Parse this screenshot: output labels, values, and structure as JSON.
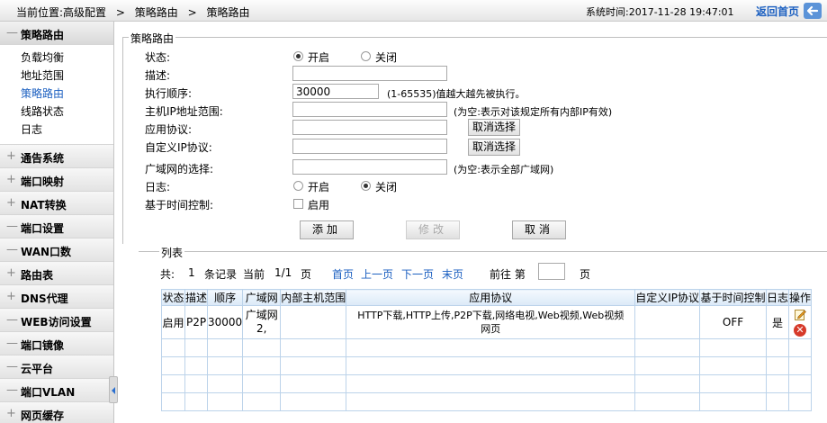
{
  "topbar": {
    "location_label": "当前位置:高级配置",
    "crumb_1": "策略路由",
    "crumb_2": "策略路由",
    "systime_label": "系统时间:",
    "systime_value": "2017-11-28 19:47:01",
    "home_link": "返回首页"
  },
  "sidebar": {
    "groups": [
      {
        "label": "策略路由",
        "state": "—"
      },
      {
        "label": "通告系统",
        "state": "+"
      },
      {
        "label": "端口映射",
        "state": "+"
      },
      {
        "label": "NAT转换",
        "state": "+"
      },
      {
        "label": "端口设置",
        "state": "—"
      },
      {
        "label": "WAN口数",
        "state": "—"
      },
      {
        "label": "路由表",
        "state": "+"
      },
      {
        "label": "DNS代理",
        "state": "+"
      },
      {
        "label": "WEB访问设置",
        "state": "—"
      },
      {
        "label": "端口镜像",
        "state": "—"
      },
      {
        "label": "云平台",
        "state": "—"
      },
      {
        "label": "端口VLAN",
        "state": "—"
      },
      {
        "label": "网页缓存",
        "state": "+"
      }
    ],
    "subitems": [
      "负载均衡",
      "地址范围",
      "策略路由",
      "线路状态",
      "日志"
    ]
  },
  "form": {
    "legend": "策略路由",
    "state_label": "状态:",
    "state_on": "开启",
    "state_off": "关闭",
    "desc_label": "描述:",
    "desc_value": "",
    "order_label": "执行顺序:",
    "order_value": "30000",
    "order_hint": "(1-65535)值越大越先被执行。",
    "host_label": "主机IP地址范围:",
    "host_value": "",
    "host_hint": "(为空:表示对该规定所有内部IP有效)",
    "app_label": "应用协议:",
    "app_value": "",
    "cancel_select": "取消选择",
    "custom_label": "自定义IP协议:",
    "custom_value": "",
    "wan_label": "广域网的选择:",
    "wan_value": "",
    "wan_hint": "(为空:表示全部广域网)",
    "log_label": "日志:",
    "log_on": "开启",
    "log_off": "关闭",
    "time_label": "基于时间控制:",
    "time_enable": "启用",
    "btn_add": "添加",
    "btn_modify": "修改",
    "btn_cancel": "取消"
  },
  "list": {
    "legend": "列表",
    "total_prefix": "共:",
    "total_count": "1",
    "total_suffix": "条记录",
    "current_label": "当前",
    "page_info": "1/1",
    "page_unit": "页",
    "first": "首页",
    "prev": "上一页",
    "next": "下一页",
    "last": "末页",
    "goto_label": "前往 第",
    "goto_value": "",
    "goto_unit": "页",
    "columns": [
      "状态",
      "描述",
      "顺序",
      "广域网",
      "内部主机范围",
      "应用协议",
      "自定义IP协议",
      "基于时间控制",
      "日志",
      "操作"
    ],
    "rows": [
      {
        "status": "启用",
        "desc": "P2P",
        "order": "30000",
        "wan_line1": "广域网",
        "wan_line2": "2,",
        "host": "",
        "app_line1": "HTTP下载,HTTP上传,P2P下载,网络电视,Web视频,Web视频",
        "app_line2": "网页",
        "custom": "",
        "time": "OFF",
        "log": "是"
      }
    ]
  },
  "colors": {
    "link": "#1b5fc0",
    "table_border": "#bcd3ea",
    "delete": "#d63a2a"
  },
  "icons": {
    "edit": "edit-icon",
    "delete": "delete-icon",
    "home": "back-arrow-icon"
  }
}
